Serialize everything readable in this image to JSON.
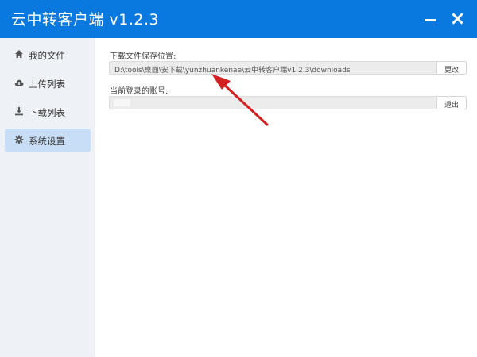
{
  "window": {
    "title": "云中转客户端 v1.2.3"
  },
  "sidebar": {
    "items": [
      {
        "label": "我的文件",
        "icon": "home-icon"
      },
      {
        "label": "上传列表",
        "icon": "cloud-upload-icon"
      },
      {
        "label": "下载列表",
        "icon": "download-icon"
      },
      {
        "label": "系统设置",
        "icon": "gear-icon",
        "active": true
      }
    ]
  },
  "settings": {
    "download_label": "下载文件保存位置:",
    "download_path": "D:\\tools\\桌面\\安下载\\yunzhuankenae\\云中转客户端v1.2.3\\downloads",
    "change_button": "更改",
    "account_label": "当前登录的账号:",
    "account_value": "",
    "logout_button": "退出"
  },
  "colors": {
    "titlebar": "#0a79df",
    "sidebar": "#eef1f5",
    "active_item": "#c8def6",
    "annotation_arrow": "#d42020"
  }
}
